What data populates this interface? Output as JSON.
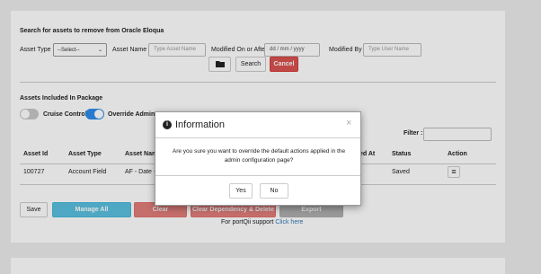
{
  "search": {
    "title": "Search for assets to remove from Oracle Eloqua",
    "asset_type_label": "Asset Type",
    "asset_type_value": "--Select--",
    "asset_name_label": "Asset Name",
    "asset_name_placeholder": "Type Asset Name",
    "modified_label": "Modified On or After",
    "modified_placeholder": "dd / mm / yyyy",
    "modified_by_label": "Modified By",
    "modified_by_placeholder": "Type User Name",
    "search_button": "Search",
    "cancel_button": "Cancel"
  },
  "package": {
    "title": "Assets Included In Package",
    "cruise_control_label": "Cruise Control",
    "override_label": "Override Admin D",
    "filter_label": "Filter :",
    "columns": [
      "Asset Id",
      "Asset Type",
      "Asset Name",
      "ed At",
      "Status",
      "Action"
    ],
    "rows": [
      {
        "asset_id": "100727",
        "asset_type": "Account Field",
        "asset_name": "AF - Date - C",
        "status": "Saved"
      }
    ]
  },
  "footer": {
    "save": "Save",
    "manage_all": "Manage All Dependencies",
    "clear_dependency": "Clear Dependency",
    "clear_delete": "Clear Dependency & Delete",
    "export": "Export Dependencies",
    "support_text": "For portQii support",
    "support_link": "Click here"
  },
  "modal": {
    "title": "Information",
    "close": "×",
    "message": "Are you sure you want to override the default actions applied in the admin configuration page?",
    "yes": "Yes",
    "no": "No"
  },
  "colors": {
    "toggle_on": "#2d8ceb",
    "toggle_off": "#c8c8c8",
    "danger": "#d9534f",
    "info": "#5bc0de"
  }
}
